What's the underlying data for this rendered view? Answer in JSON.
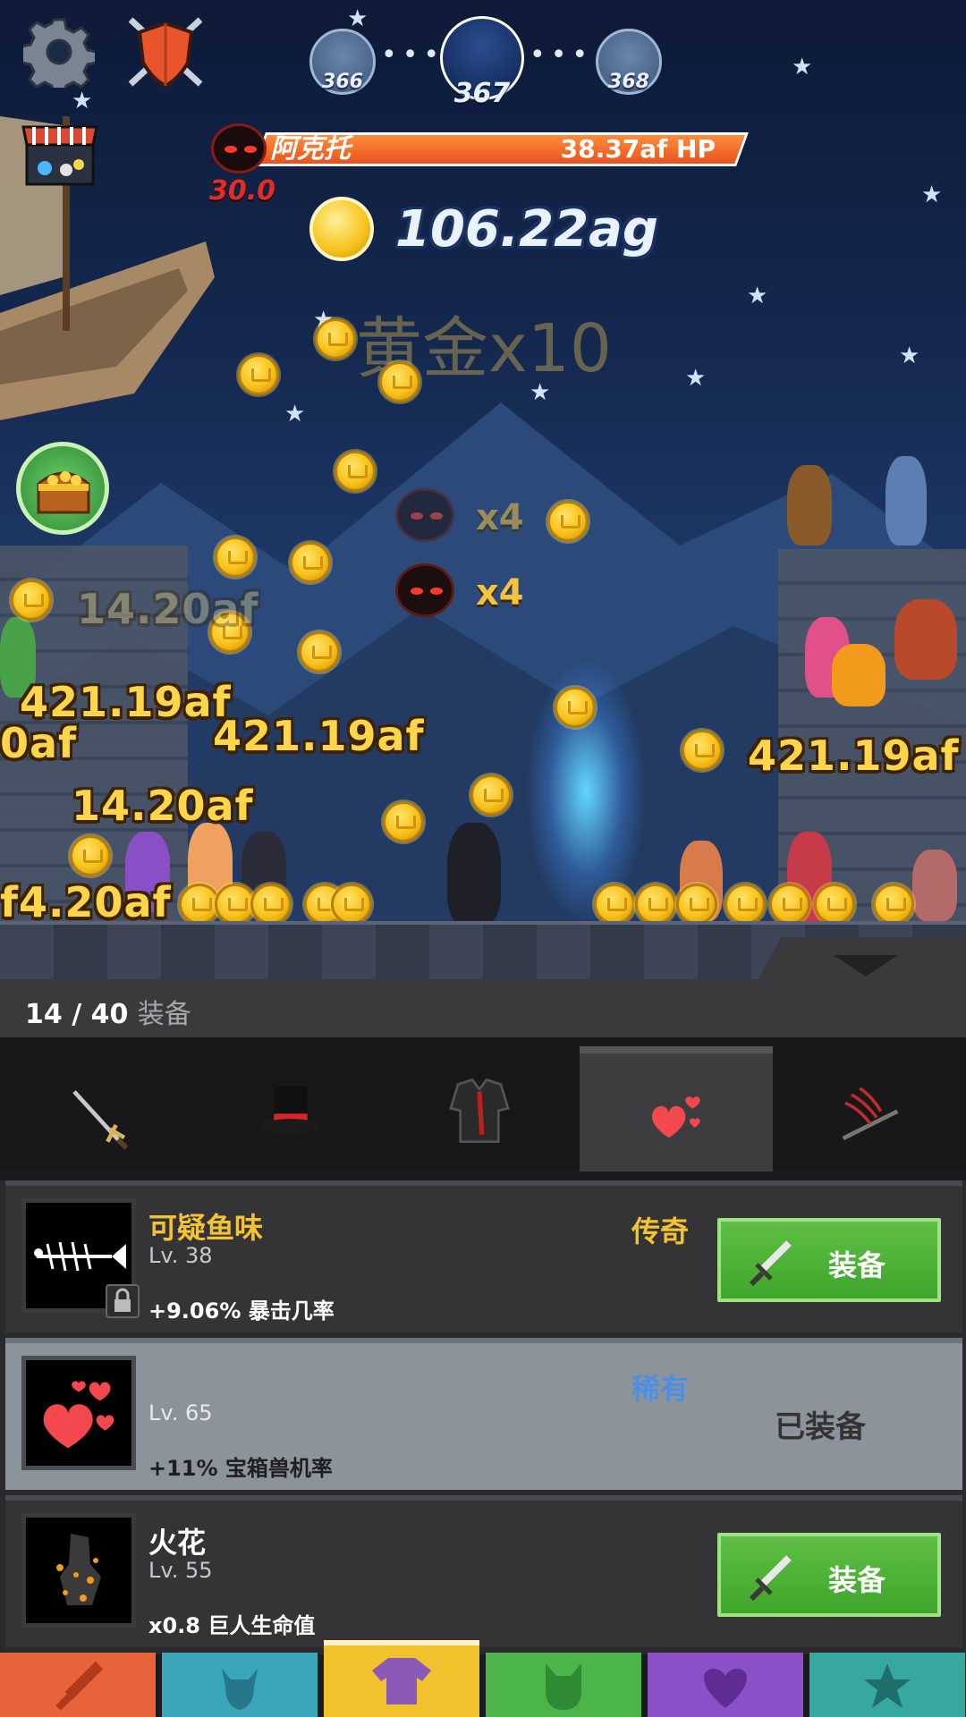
{
  "hud": {
    "stages": [
      "366",
      "367",
      "368"
    ],
    "boss_name": "阿克托",
    "boss_hp": "38.37af HP",
    "timer": "30.0",
    "gold": "106.22ag",
    "gold_multiplier": "黄金x10",
    "demon_counts": [
      "x4",
      "x4"
    ]
  },
  "scene": {
    "damage_numbers": [
      "421.19af",
      "421.19af",
      "421.19af",
      "14.20af",
      "14.20af",
      "f4.20af",
      "0af"
    ]
  },
  "equipment": {
    "count": "14 / 40",
    "count_label": "装备",
    "tabs": [
      "sword",
      "hat",
      "armor",
      "hearts",
      "flame-blade"
    ],
    "selected_tab": 3,
    "items": [
      {
        "name": "可疑鱼味",
        "level": "Lv. 38",
        "rarity": "传奇",
        "rarity_color": "#f5c330",
        "stat": "+9.06% 暴击几率",
        "action": "装备",
        "locked": true,
        "equipped": false
      },
      {
        "name": "",
        "level": "Lv. 65",
        "rarity": "稀有",
        "rarity_color": "#4e8fe6",
        "stat": "+11% 宝箱兽机率",
        "action": "已装备",
        "equipped": true
      },
      {
        "name": "火花",
        "level": "Lv. 55",
        "rarity": "",
        "stat": "x0.8 巨人生命值",
        "action": "装备",
        "equipped": false
      }
    ]
  },
  "nav": {
    "items": [
      "sword-icon",
      "knight-icon",
      "shirt-icon",
      "beast-icon",
      "heart-wings-icon",
      "star-icon"
    ],
    "colors": [
      "#e8623a",
      "#3aa6b9",
      "#f2c12e",
      "#4cb54a",
      "#8b4fc7",
      "#37a8a0"
    ],
    "selected": 2
  }
}
